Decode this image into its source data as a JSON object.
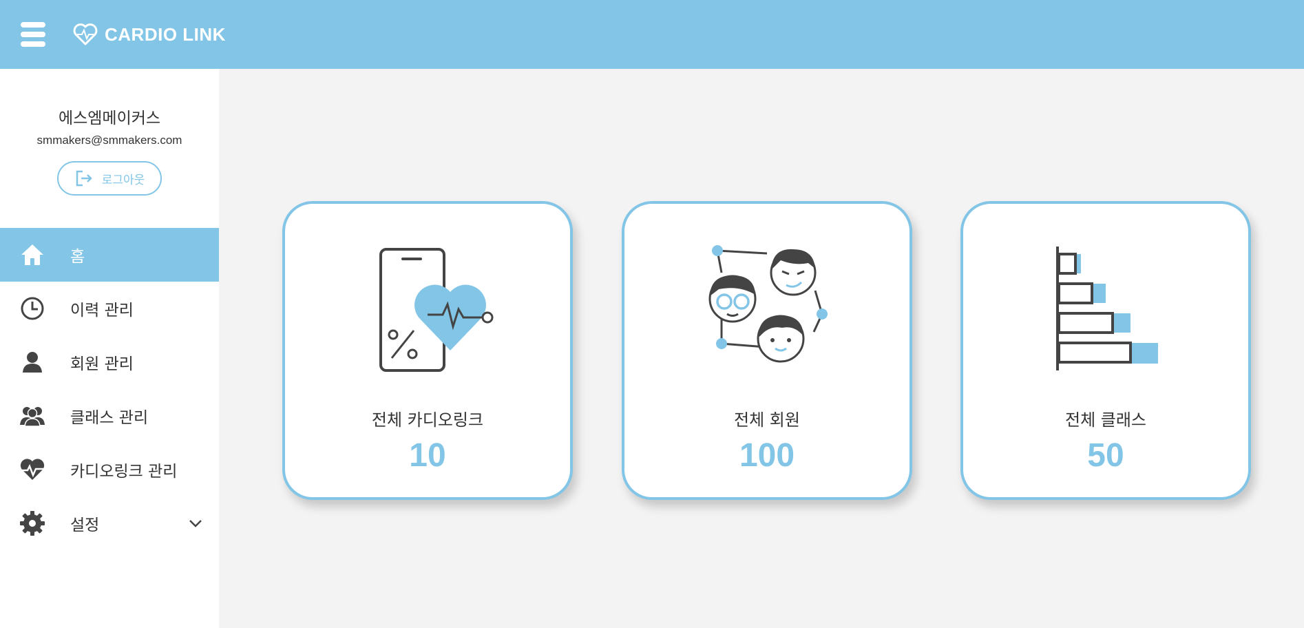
{
  "app": {
    "brand": "CARDIO LINK"
  },
  "colors": {
    "accent": "#82c5e6",
    "dark": "#444444"
  },
  "profile": {
    "name": "에스엠메이커스",
    "email": "smmakers@smmakers.com",
    "logout_label": "로그아웃"
  },
  "nav": {
    "items": [
      {
        "label": "홈",
        "icon": "home-icon",
        "active": true
      },
      {
        "label": "이력 관리",
        "icon": "clock-icon"
      },
      {
        "label": "회원 관리",
        "icon": "user-icon"
      },
      {
        "label": "클래스 관리",
        "icon": "users-icon"
      },
      {
        "label": "카디오링크 관리",
        "icon": "heart-pulse-icon"
      },
      {
        "label": "설정",
        "icon": "gear-icon",
        "expandable": true
      }
    ]
  },
  "cards": [
    {
      "title": "전체 카디오링크",
      "value": "10",
      "icon": "phone-heart-icon"
    },
    {
      "title": "전체 회원",
      "value": "100",
      "icon": "people-network-icon"
    },
    {
      "title": "전체 클래스",
      "value": "50",
      "icon": "bar-chart-icon"
    }
  ]
}
